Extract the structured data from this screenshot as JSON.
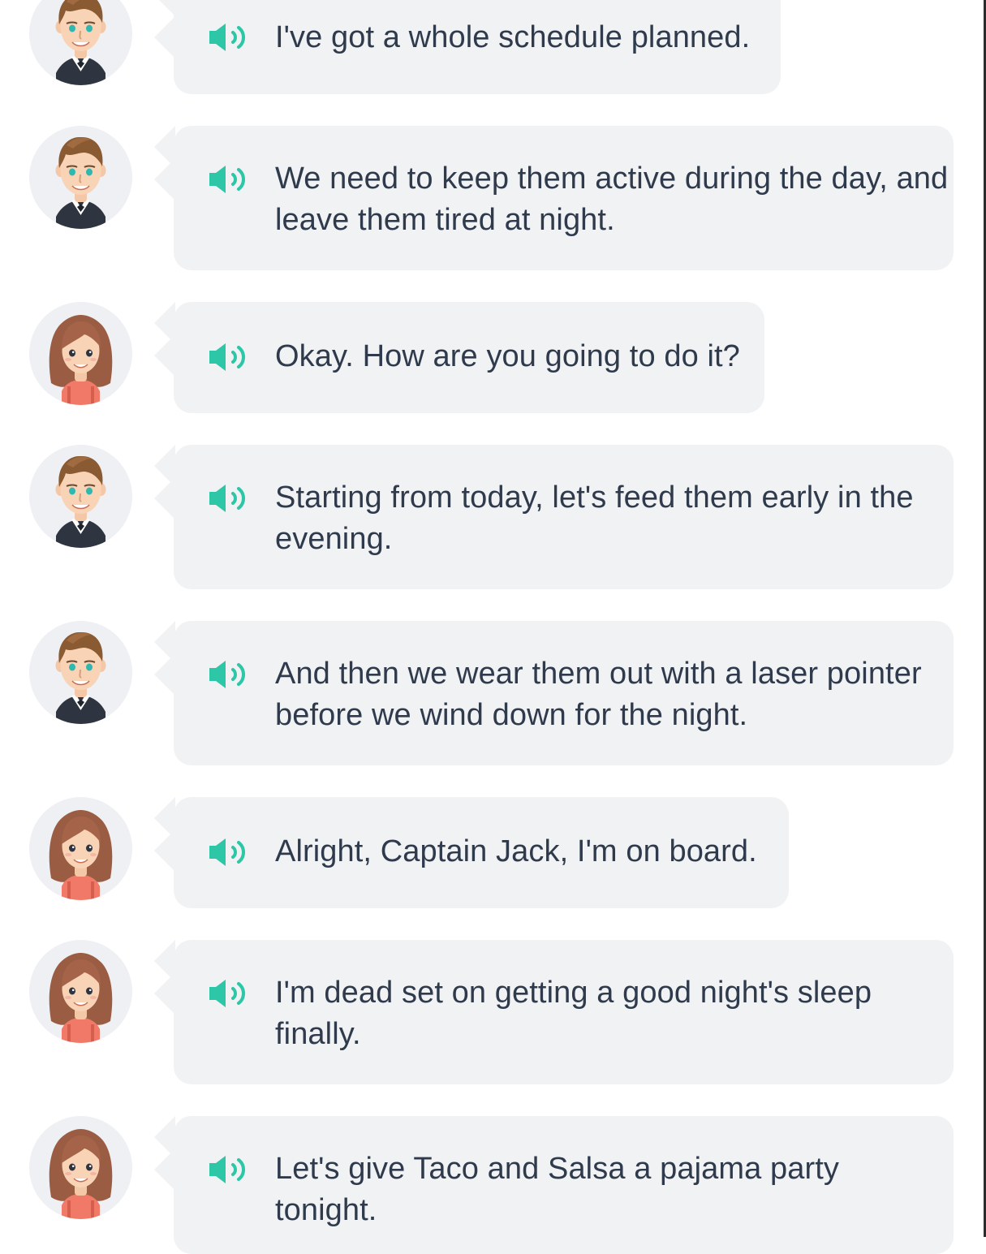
{
  "colors": {
    "speaker": "#2dc6a7",
    "bubble": "#f1f2f4",
    "text": "#2f3b4c",
    "avatar_bg": "#eef0f3"
  },
  "messages": [
    {
      "speaker_role": "male",
      "text": "I've got a whole schedule planned."
    },
    {
      "speaker_role": "male",
      "text": "We need to keep them active during the day, and leave them tired at night."
    },
    {
      "speaker_role": "female",
      "text": "Okay. How are you going to do it?"
    },
    {
      "speaker_role": "male",
      "text": "Starting from today, let's feed them early in the evening."
    },
    {
      "speaker_role": "male",
      "text": "And then we wear them out with a laser pointer before we wind down for the night."
    },
    {
      "speaker_role": "female",
      "text": "Alright, Captain Jack, I'm on board."
    },
    {
      "speaker_role": "female",
      "text": "I'm dead set on getting a good night's sleep finally."
    },
    {
      "speaker_role": "female",
      "text": "Let's give Taco and Salsa a pajama party tonight."
    }
  ],
  "icons": {
    "speaker": "speaker-icon",
    "avatar_male": "male-avatar",
    "avatar_female": "female-avatar"
  }
}
